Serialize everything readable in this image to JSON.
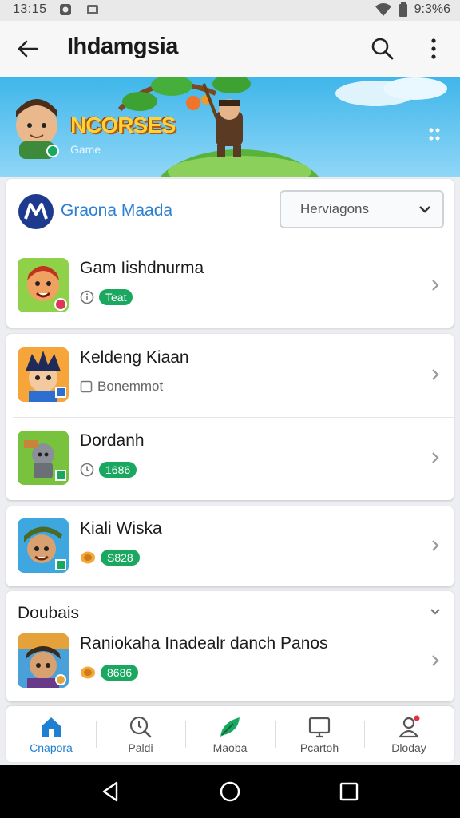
{
  "status_bar": {
    "time": "13:15",
    "battery": "9:3%6"
  },
  "app_bar": {
    "title": "Ihdamgsia"
  },
  "banner": {
    "title": "NCORSES",
    "subtitle": "Game"
  },
  "section_header": {
    "title": "Graona Maada",
    "dropdown_value": "Herviagons"
  },
  "games": [
    {
      "name": "Gam Iishdnurma",
      "tag": "Teat",
      "meta_icon": "info-icon",
      "meta_style": "pill"
    },
    {
      "name": "Keldeng Kiaan",
      "tag": "Bonemmot",
      "meta_icon": "square-icon",
      "meta_style": "text"
    },
    {
      "name": "Dordanh",
      "tag": "1686",
      "meta_icon": "clock-icon",
      "meta_style": "pill"
    },
    {
      "name": "Kiali Wiska",
      "tag": "S828",
      "meta_icon": "coin-icon",
      "meta_style": "pill"
    },
    {
      "name": "Raniokaha Inadealr danch Panos",
      "tag": "8686",
      "meta_icon": "coin-icon",
      "meta_style": "pill"
    }
  ],
  "section2": {
    "title": "Doubais"
  },
  "bottom_nav": [
    {
      "label": "Cnapora",
      "icon": "home-icon",
      "active": true
    },
    {
      "label": "Paldi",
      "icon": "search-icon",
      "active": false
    },
    {
      "label": "Maoba",
      "icon": "leaf-icon",
      "active": false
    },
    {
      "label": "Pcartoh",
      "icon": "tablet-icon",
      "active": false
    },
    {
      "label": "Dloday",
      "icon": "profile-icon",
      "active": false
    }
  ],
  "colors": {
    "accent": "#1f7fd0",
    "pill": "#1aa760",
    "banner_sky": "#3fb6ea"
  }
}
